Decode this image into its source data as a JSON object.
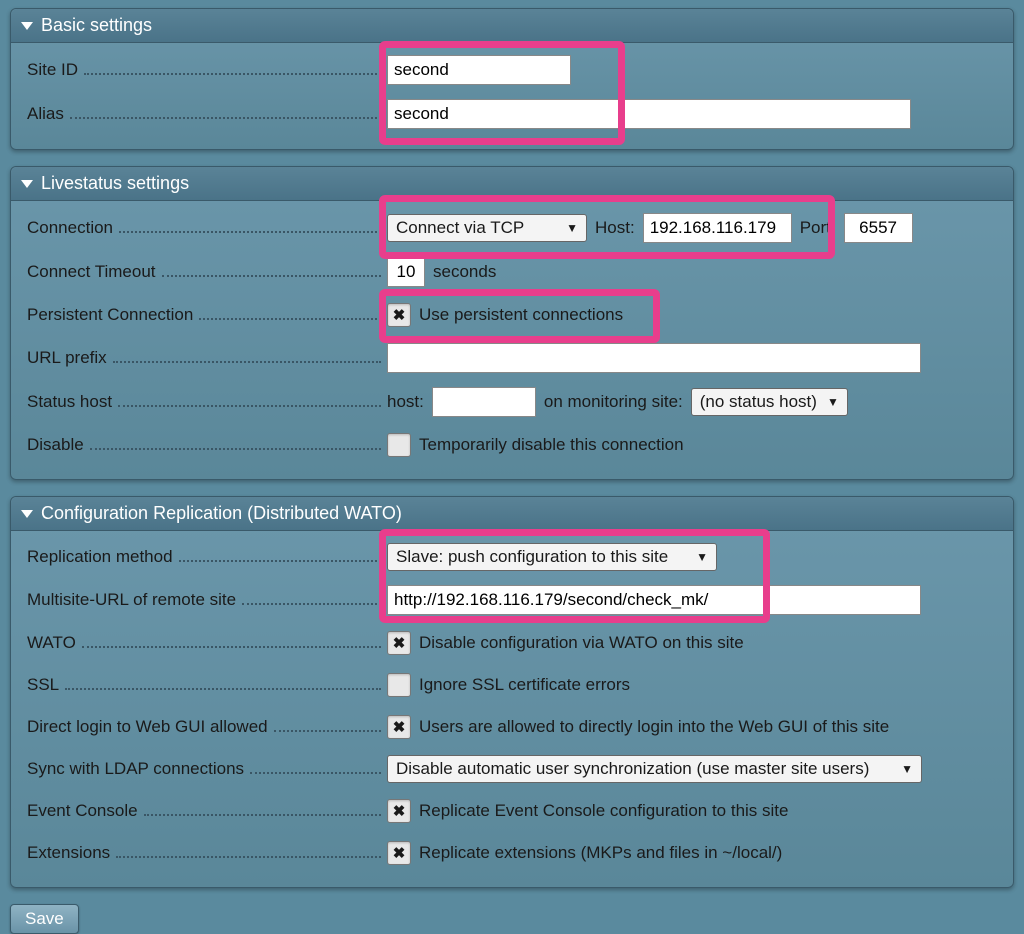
{
  "sections": {
    "basic": {
      "title": "Basic settings",
      "site_id": {
        "label": "Site ID",
        "value": "second"
      },
      "alias": {
        "label": "Alias",
        "value": "second"
      }
    },
    "livestatus": {
      "title": "Livestatus settings",
      "connection": {
        "label": "Connection",
        "method": "Connect via TCP",
        "host_label": "Host:",
        "host": "192.168.116.179",
        "port_label": "Port:",
        "port": "6557"
      },
      "timeout": {
        "label": "Connect Timeout",
        "value": "10",
        "unit": "seconds"
      },
      "persistent": {
        "label": "Persistent Connection",
        "checkbox_label": "Use persistent connections",
        "checked": true
      },
      "url_prefix": {
        "label": "URL prefix",
        "value": ""
      },
      "status_host": {
        "label": "Status host",
        "host_label": "host:",
        "host": "",
        "on_label": "on monitoring site:",
        "site": "(no status host)"
      },
      "disable": {
        "label": "Disable",
        "checkbox_label": "Temporarily disable this connection",
        "checked": false
      }
    },
    "replication": {
      "title": "Configuration Replication (Distributed WATO)",
      "method": {
        "label": "Replication method",
        "value": "Slave: push configuration to this site"
      },
      "multisite_url": {
        "label": "Multisite-URL of remote site",
        "value": "http://192.168.116.179/second/check_mk/"
      },
      "wato": {
        "label": "WATO",
        "checkbox_label": "Disable configuration via WATO on this site",
        "checked": true
      },
      "ssl": {
        "label": "SSL",
        "checkbox_label": "Ignore SSL certificate errors",
        "checked": false
      },
      "direct_login": {
        "label": "Direct login to Web GUI allowed",
        "checkbox_label": "Users are allowed to directly login into the Web GUI of this site",
        "checked": true
      },
      "ldap_sync": {
        "label": "Sync with LDAP connections",
        "value": "Disable automatic user synchronization (use master site users)"
      },
      "event_console": {
        "label": "Event Console",
        "checkbox_label": "Replicate Event Console configuration to this site",
        "checked": true
      },
      "extensions": {
        "label": "Extensions",
        "checkbox_label": "Replicate extensions (MKPs and files in ~/local/)",
        "checked": true
      }
    }
  },
  "save_label": "Save"
}
